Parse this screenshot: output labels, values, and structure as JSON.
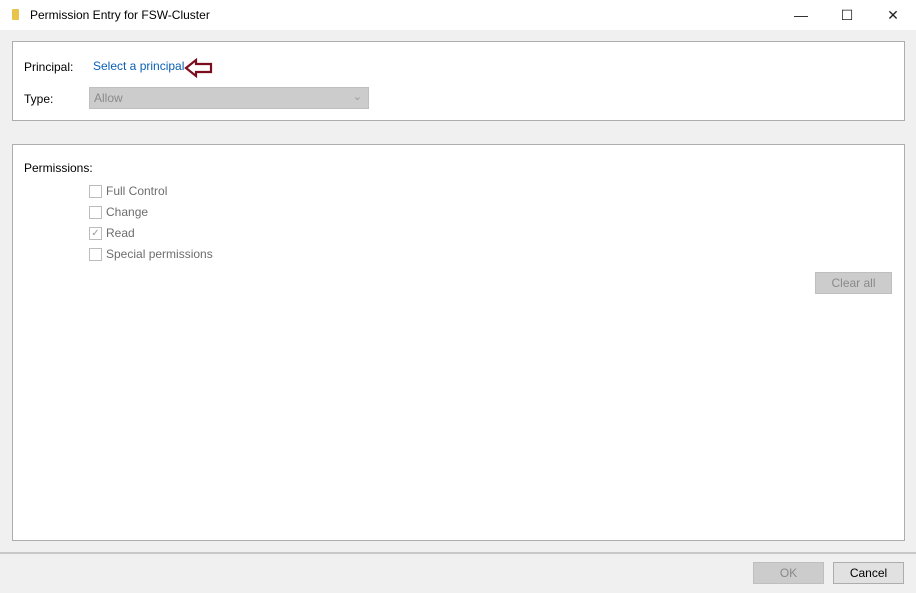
{
  "window": {
    "title": "Permission Entry for FSW-Cluster",
    "minimize": "—",
    "maximize": "☐",
    "close": "✕"
  },
  "principal": {
    "label": "Principal:",
    "link": "Select a principal",
    "annotation": "arrow-left-icon",
    "annotation_color": "#7a0e1e"
  },
  "type": {
    "label": "Type:",
    "value": "Allow"
  },
  "permissions": {
    "label": "Permissions:",
    "items": [
      {
        "label": "Full Control",
        "checked": false
      },
      {
        "label": "Change",
        "checked": false
      },
      {
        "label": "Read",
        "checked": true
      },
      {
        "label": "Special permissions",
        "checked": false
      }
    ],
    "clear_all": "Clear all"
  },
  "footer": {
    "ok": "OK",
    "cancel": "Cancel"
  }
}
